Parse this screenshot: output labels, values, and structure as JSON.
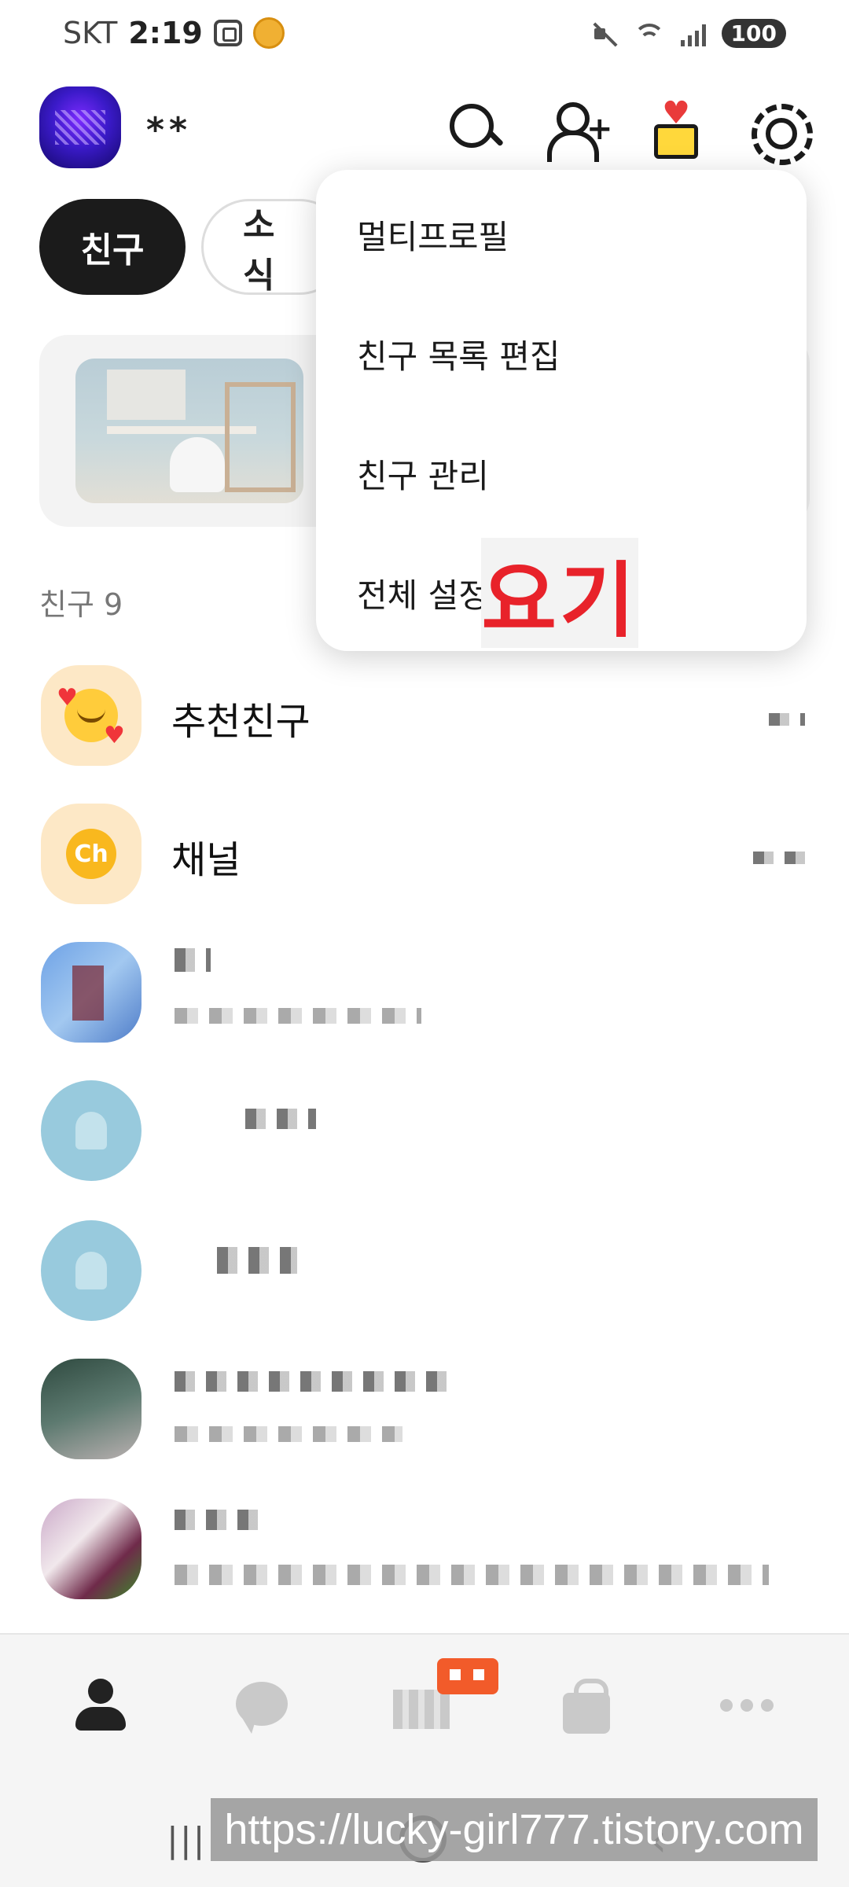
{
  "status_bar": {
    "carrier": "SKT",
    "time": "2:19",
    "battery": "100"
  },
  "header": {
    "my_name": "**"
  },
  "tabs": [
    {
      "label": "친구"
    },
    {
      "label": "소식"
    }
  ],
  "friends_section": {
    "count_label": "친구 9"
  },
  "list": {
    "recommended": {
      "label": "추천친구"
    },
    "channel": {
      "label": "채널",
      "badge": "Ch"
    }
  },
  "dropdown_menu": {
    "items": [
      {
        "label": "멀티프로필"
      },
      {
        "label": "친구 목록 편집"
      },
      {
        "label": "친구 관리"
      },
      {
        "label": "전체 설정"
      }
    ]
  },
  "annotation": {
    "text": "요기",
    "color": "#e8222a"
  },
  "gesture_bar": {
    "recent": "|||"
  },
  "watermark": "https://lucky-girl777.tistory.com",
  "colors": {
    "tab_active_bg": "#1b1b1b",
    "nav_badge": "#f25b2a",
    "channel_icon": "#f9b81e"
  }
}
